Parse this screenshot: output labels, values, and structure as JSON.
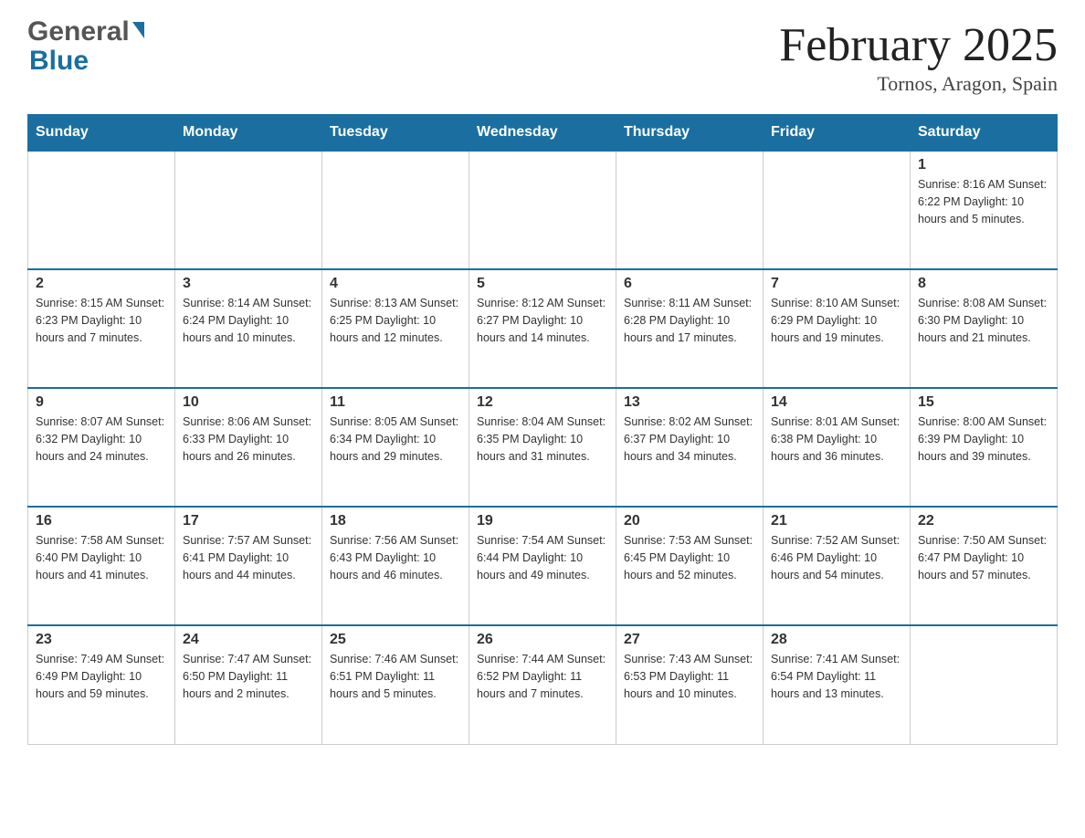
{
  "header": {
    "logo_general": "General",
    "logo_blue": "Blue",
    "month_year": "February 2025",
    "location": "Tornos, Aragon, Spain"
  },
  "days_of_week": [
    "Sunday",
    "Monday",
    "Tuesday",
    "Wednesday",
    "Thursday",
    "Friday",
    "Saturday"
  ],
  "weeks": [
    [
      {
        "date": "",
        "info": ""
      },
      {
        "date": "",
        "info": ""
      },
      {
        "date": "",
        "info": ""
      },
      {
        "date": "",
        "info": ""
      },
      {
        "date": "",
        "info": ""
      },
      {
        "date": "",
        "info": ""
      },
      {
        "date": "1",
        "info": "Sunrise: 8:16 AM\nSunset: 6:22 PM\nDaylight: 10 hours and 5 minutes."
      }
    ],
    [
      {
        "date": "2",
        "info": "Sunrise: 8:15 AM\nSunset: 6:23 PM\nDaylight: 10 hours and 7 minutes."
      },
      {
        "date": "3",
        "info": "Sunrise: 8:14 AM\nSunset: 6:24 PM\nDaylight: 10 hours and 10 minutes."
      },
      {
        "date": "4",
        "info": "Sunrise: 8:13 AM\nSunset: 6:25 PM\nDaylight: 10 hours and 12 minutes."
      },
      {
        "date": "5",
        "info": "Sunrise: 8:12 AM\nSunset: 6:27 PM\nDaylight: 10 hours and 14 minutes."
      },
      {
        "date": "6",
        "info": "Sunrise: 8:11 AM\nSunset: 6:28 PM\nDaylight: 10 hours and 17 minutes."
      },
      {
        "date": "7",
        "info": "Sunrise: 8:10 AM\nSunset: 6:29 PM\nDaylight: 10 hours and 19 minutes."
      },
      {
        "date": "8",
        "info": "Sunrise: 8:08 AM\nSunset: 6:30 PM\nDaylight: 10 hours and 21 minutes."
      }
    ],
    [
      {
        "date": "9",
        "info": "Sunrise: 8:07 AM\nSunset: 6:32 PM\nDaylight: 10 hours and 24 minutes."
      },
      {
        "date": "10",
        "info": "Sunrise: 8:06 AM\nSunset: 6:33 PM\nDaylight: 10 hours and 26 minutes."
      },
      {
        "date": "11",
        "info": "Sunrise: 8:05 AM\nSunset: 6:34 PM\nDaylight: 10 hours and 29 minutes."
      },
      {
        "date": "12",
        "info": "Sunrise: 8:04 AM\nSunset: 6:35 PM\nDaylight: 10 hours and 31 minutes."
      },
      {
        "date": "13",
        "info": "Sunrise: 8:02 AM\nSunset: 6:37 PM\nDaylight: 10 hours and 34 minutes."
      },
      {
        "date": "14",
        "info": "Sunrise: 8:01 AM\nSunset: 6:38 PM\nDaylight: 10 hours and 36 minutes."
      },
      {
        "date": "15",
        "info": "Sunrise: 8:00 AM\nSunset: 6:39 PM\nDaylight: 10 hours and 39 minutes."
      }
    ],
    [
      {
        "date": "16",
        "info": "Sunrise: 7:58 AM\nSunset: 6:40 PM\nDaylight: 10 hours and 41 minutes."
      },
      {
        "date": "17",
        "info": "Sunrise: 7:57 AM\nSunset: 6:41 PM\nDaylight: 10 hours and 44 minutes."
      },
      {
        "date": "18",
        "info": "Sunrise: 7:56 AM\nSunset: 6:43 PM\nDaylight: 10 hours and 46 minutes."
      },
      {
        "date": "19",
        "info": "Sunrise: 7:54 AM\nSunset: 6:44 PM\nDaylight: 10 hours and 49 minutes."
      },
      {
        "date": "20",
        "info": "Sunrise: 7:53 AM\nSunset: 6:45 PM\nDaylight: 10 hours and 52 minutes."
      },
      {
        "date": "21",
        "info": "Sunrise: 7:52 AM\nSunset: 6:46 PM\nDaylight: 10 hours and 54 minutes."
      },
      {
        "date": "22",
        "info": "Sunrise: 7:50 AM\nSunset: 6:47 PM\nDaylight: 10 hours and 57 minutes."
      }
    ],
    [
      {
        "date": "23",
        "info": "Sunrise: 7:49 AM\nSunset: 6:49 PM\nDaylight: 10 hours and 59 minutes."
      },
      {
        "date": "24",
        "info": "Sunrise: 7:47 AM\nSunset: 6:50 PM\nDaylight: 11 hours and 2 minutes."
      },
      {
        "date": "25",
        "info": "Sunrise: 7:46 AM\nSunset: 6:51 PM\nDaylight: 11 hours and 5 minutes."
      },
      {
        "date": "26",
        "info": "Sunrise: 7:44 AM\nSunset: 6:52 PM\nDaylight: 11 hours and 7 minutes."
      },
      {
        "date": "27",
        "info": "Sunrise: 7:43 AM\nSunset: 6:53 PM\nDaylight: 11 hours and 10 minutes."
      },
      {
        "date": "28",
        "info": "Sunrise: 7:41 AM\nSunset: 6:54 PM\nDaylight: 11 hours and 13 minutes."
      },
      {
        "date": "",
        "info": ""
      }
    ]
  ]
}
